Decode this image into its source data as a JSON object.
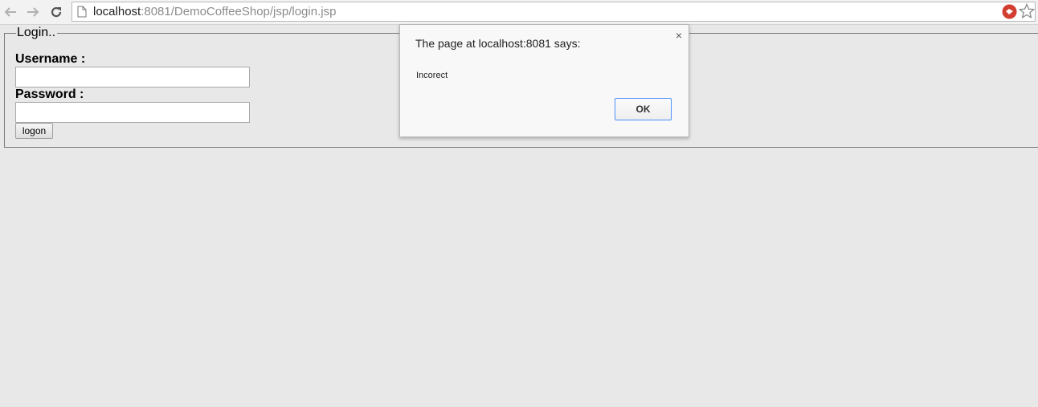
{
  "browser": {
    "url_host": "localhost",
    "url_rest": ":8081/DemoCoffeeShop/jsp/login.jsp"
  },
  "form": {
    "legend": "Login..",
    "username_label": "Username :",
    "username_value": "",
    "password_label": "Password :",
    "password_value": "",
    "submit_label": "logon"
  },
  "dialog": {
    "title": "The page at localhost:8081 says:",
    "close_glyph": "×",
    "message": "Incorect",
    "ok_label": "OK"
  },
  "colors": {
    "page_background": "#e8e8e8",
    "dialog_background": "#f8f8f8",
    "ok_button_border": "#4d90fe"
  }
}
